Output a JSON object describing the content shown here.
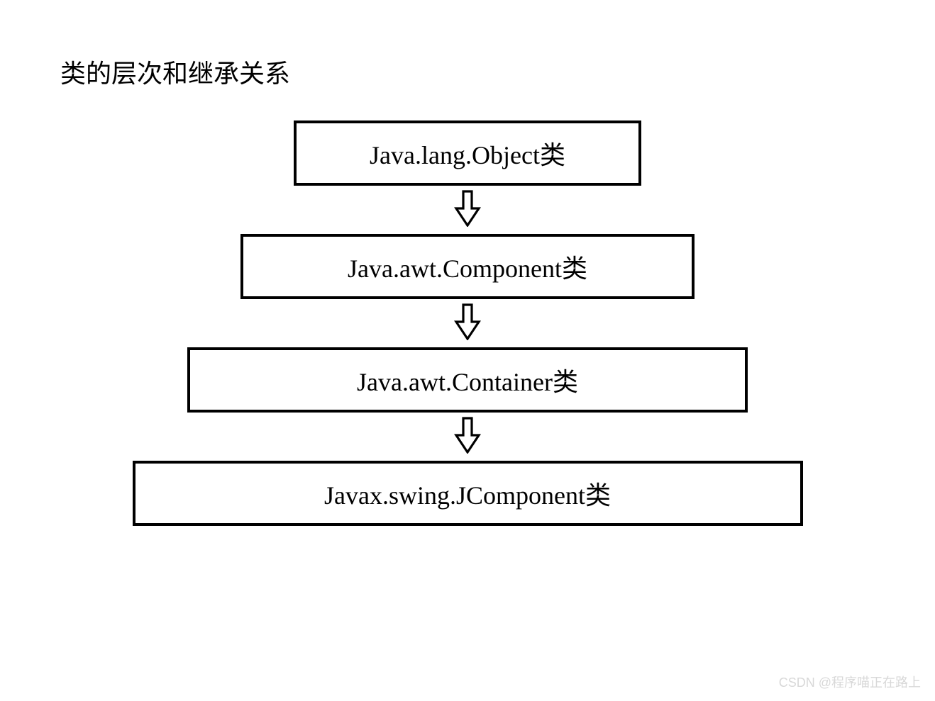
{
  "title": "类的层次和继承关系",
  "hierarchy": {
    "level1": "Java.lang.Object类",
    "level2": "Java.awt.Component类",
    "level3": "Java.awt.Container类",
    "level4": "Javax.swing.JComponent类"
  },
  "watermark": "CSDN @程序喵正在路上"
}
